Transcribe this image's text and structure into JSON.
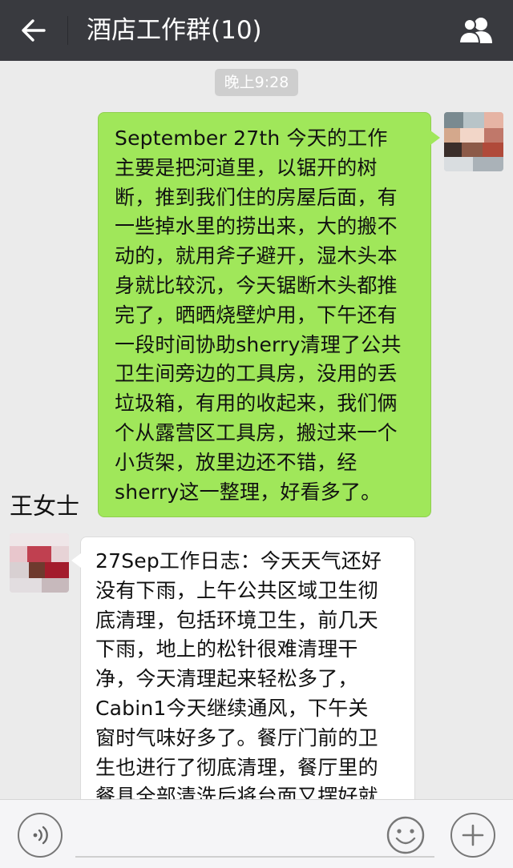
{
  "header": {
    "title": "酒店工作群(10)",
    "back_icon": "arrow-left-icon",
    "members_icon": "group-members-icon"
  },
  "chat": {
    "timestamp": "晚上9:28",
    "messages": [
      {
        "sender": "self",
        "bubble_color": "#a0e75a",
        "lines": [
          "September 27th  今天的工作",
          "主要是把河道里，以锯开的树",
          "断，推到我们住的房屋后面，有",
          "一些掉水里的捞出来，大的搬不",
          "动的，就用斧子避开，湿木头本",
          "身就比较沉，今天锯断木头都推",
          "完了，晒晒烧壁炉用，下午还有",
          "一段时间协助sherry清理了公共",
          "卫生间旁边的工具房，没用的丢",
          "垃圾箱，有用的收起来，我们俩",
          "个从露营区工具房，搬过来一个",
          "小货架，放里边还不错，经",
          "sherry这一整理，好看多了。"
        ]
      },
      {
        "sender": "王女士",
        "bubble_color": "#ffffff",
        "lines": [
          "27Sep工作日志：今天天气还好",
          "没有下雨，上午公共区域卫生彻",
          "底清理，包括环境卫生，前几天",
          "下雨，地上的松针很难清理干",
          "净，今天清理起来轻松多了，",
          "Cabin1今天继续通风，下午关",
          "窗时气味好多了。餐厅门前的卫",
          "生也进行了彻底清理，餐厅里的",
          "餐具全部清洗后将台面又摆好就"
        ]
      }
    ]
  },
  "input_bar": {
    "voice_icon": "voice-icon",
    "emoji_icon": "emoji-icon",
    "plus_icon": "plus-icon",
    "input_value": ""
  },
  "colors": {
    "header_bg": "#393a3f",
    "chat_bg": "#ebebeb",
    "self_bubble": "#a0e75a"
  }
}
